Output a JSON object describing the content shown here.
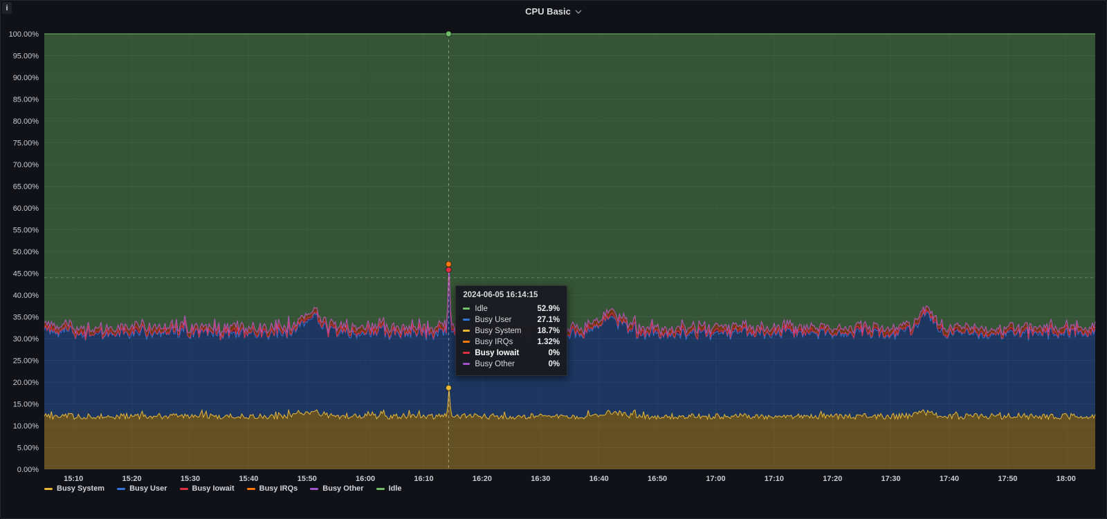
{
  "panel": {
    "title": "CPU Basic",
    "info_icon": "i"
  },
  "tooltip": {
    "timestamp": "2024-06-05 16:14:15",
    "rows": [
      {
        "name": "Idle",
        "value": "52.9%",
        "color": "#73BF69",
        "bold": false
      },
      {
        "name": "Busy User",
        "value": "27.1%",
        "color": "#3274D9",
        "bold": false
      },
      {
        "name": "Busy System",
        "value": "18.7%",
        "color": "#EAB839",
        "bold": false
      },
      {
        "name": "Busy IRQs",
        "value": "1.32%",
        "color": "#FF780A",
        "bold": false
      },
      {
        "name": "Busy Iowait",
        "value": "0%",
        "color": "#E02F44",
        "bold": true
      },
      {
        "name": "Busy Other",
        "value": "0%",
        "color": "#A352CC",
        "bold": false
      }
    ]
  },
  "chart_data": {
    "type": "area",
    "stacked": true,
    "title": "CPU Basic",
    "unit": "%",
    "ylim": [
      0,
      100
    ],
    "y_tick_step": 5,
    "x_domain": [
      "15:05",
      "18:05"
    ],
    "x_ticks": [
      "15:10",
      "15:20",
      "15:30",
      "15:40",
      "15:50",
      "16:00",
      "16:10",
      "16:20",
      "16:30",
      "16:40",
      "16:50",
      "17:00",
      "17:10",
      "17:20",
      "17:30",
      "17:40",
      "17:50",
      "18:00"
    ],
    "legend_position": "bottom",
    "grid": true,
    "seed": 20240605,
    "series": [
      {
        "name": "Busy System",
        "color": "#EAB839",
        "base": 12.1,
        "noise": 0.8,
        "value_at_cursor": 18.7,
        "bumps": [
          {
            "time": "15:51",
            "amp": 1.2,
            "width_min": 1.8
          },
          {
            "time": "16:42",
            "amp": 0.8,
            "width_min": 2.5
          },
          {
            "time": "17:36",
            "amp": 0.9,
            "width_min": 2.0
          }
        ]
      },
      {
        "name": "Busy User",
        "color": "#3274D9",
        "base": 18.9,
        "noise": 1.2,
        "value_at_cursor": 27.1,
        "bumps": [
          {
            "time": "15:51",
            "amp": 3.2,
            "width_min": 1.8
          },
          {
            "time": "16:42",
            "amp": 2.8,
            "width_min": 2.5
          },
          {
            "time": "17:36",
            "amp": 3.0,
            "width_min": 2.0
          }
        ]
      },
      {
        "name": "Busy Iowait",
        "color": "#E02F44",
        "base": 0.3,
        "noise": 0.5,
        "value_at_cursor": 0
      },
      {
        "name": "Busy IRQs",
        "color": "#FF780A",
        "base": 1.0,
        "noise": 0.4,
        "value_at_cursor": 1.32
      },
      {
        "name": "Busy Other",
        "color": "#A352CC",
        "base": 0.0,
        "noise": 0.0,
        "value_at_cursor": 0
      },
      {
        "name": "Idle",
        "color": "#73BF69",
        "computed_as_remainder": true,
        "value_at_cursor": 52.9
      }
    ],
    "cursor": {
      "time": "16:14:15",
      "pointer_value": 44,
      "dots": [
        {
          "series": "Idle",
          "value": 100,
          "color": "#73BF69"
        },
        {
          "series": "Busy IRQs",
          "value": 47.1,
          "color": "#FF780A"
        },
        {
          "series": "Busy Iowait",
          "value": 45.8,
          "color": "#E02F44"
        },
        {
          "series": "Busy System",
          "value": 18.7,
          "color": "#EAB839"
        }
      ]
    }
  }
}
